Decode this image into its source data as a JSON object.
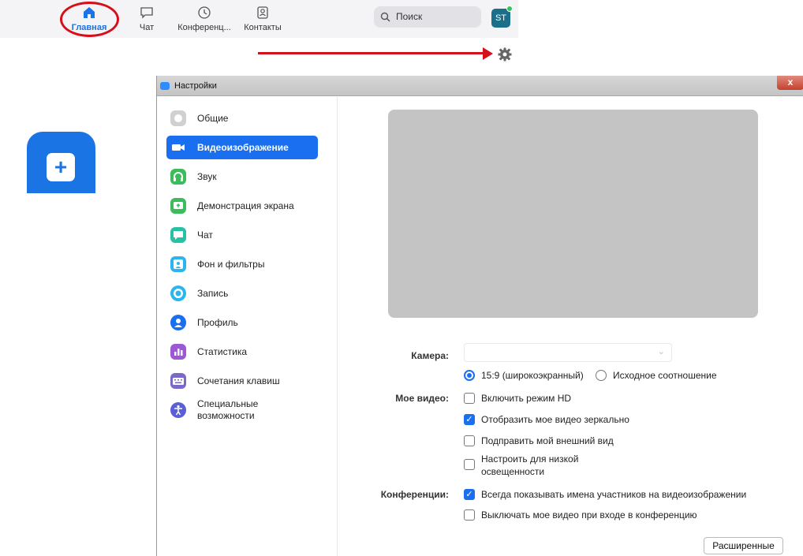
{
  "topbar": {
    "nav": [
      {
        "label": "Главная",
        "icon": "home-icon"
      },
      {
        "label": "Чат",
        "icon": "chat-icon"
      },
      {
        "label": "Конференц...",
        "icon": "clock-icon"
      },
      {
        "label": "Контакты",
        "icon": "contacts-icon"
      }
    ],
    "search_placeholder": "Поиск",
    "avatar_initials": "ST"
  },
  "window": {
    "title": "Настройки",
    "close_label": "x"
  },
  "sidebar": {
    "items": [
      {
        "label": "Общие",
        "icon": "gear-icon",
        "color": "#c7c7c7"
      },
      {
        "label": "Видеоизображение",
        "icon": "video-camera-icon",
        "color": "#1a6ff0"
      },
      {
        "label": "Звук",
        "icon": "headphones-icon",
        "color": "#3cbc5a"
      },
      {
        "label": "Демонстрация экрана",
        "icon": "share-screen-icon",
        "color": "#3cbc5a"
      },
      {
        "label": "Чат",
        "icon": "chat-icon",
        "color": "#29c1a6"
      },
      {
        "label": "Фон и фильтры",
        "icon": "background-icon",
        "color": "#29b6f0"
      },
      {
        "label": "Запись",
        "icon": "record-icon",
        "color": "#29b6f0"
      },
      {
        "label": "Профиль",
        "icon": "profile-icon",
        "color": "#1a6ff0"
      },
      {
        "label": "Статистика",
        "icon": "statistics-icon",
        "color": "#9b59d6"
      },
      {
        "label": "Сочетания клавиш",
        "icon": "keyboard-icon",
        "color": "#7b68c9"
      },
      {
        "label": "Специальные возможности",
        "icon": "accessibility-icon",
        "color": "#5a5fd6"
      }
    ]
  },
  "video": {
    "camera_label": "Камера:",
    "camera_value": "",
    "aspect_wide": "15:9 (широкоэкранный)",
    "aspect_original": "Исходное соотношение",
    "my_video_label": "Мое видео:",
    "opt_hd": "Включить режим HD",
    "opt_mirror": "Отобразить мое видео зеркально",
    "opt_touchup": "Подправить мой внешний вид",
    "opt_lowlight": "Настроить для низкой освещенности",
    "meetings_label": "Конференции:",
    "opt_names": "Всегда показывать имена участников на видеоизображении",
    "opt_off_on_join": "Выключать мое видео при входе в конференцию",
    "advanced_button": "Расширенные"
  },
  "state": {
    "aspect_wide_selected": true,
    "hd": false,
    "mirror": true,
    "touchup": false,
    "lowlight": false,
    "names": true,
    "off_on_join": false
  }
}
